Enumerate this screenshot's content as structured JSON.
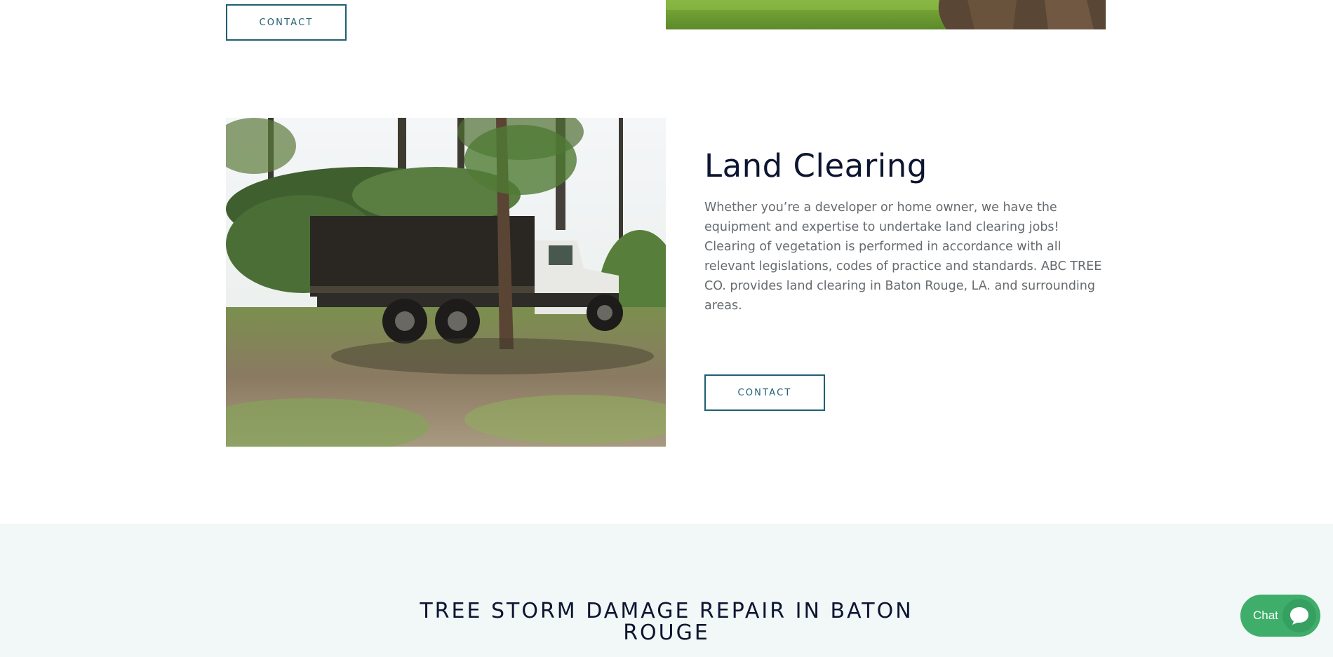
{
  "top_section": {
    "contact_label": "CONTACT"
  },
  "service": {
    "title": "Land Clearing",
    "description": "Whether you’re a developer or home owner, we have the equipment and expertise to undertake land clearing jobs! Clearing of vegetation is performed in accordance with all relevant legislations, codes of practice and standards. ABC TREE CO. provides land clearing in Baton Rouge, LA. and surrounding areas.",
    "contact_label": "CONTACT"
  },
  "next_section": {
    "title": "TREE STORM DAMAGE REPAIR IN BATON ROUGE"
  },
  "chat_widget": {
    "label": "Chat"
  },
  "colors": {
    "accent": "#1f5f73",
    "heading": "#0d1530",
    "body_text": "#666b6f",
    "band_bg": "#f2f7f7",
    "chat_green": "#3fae6a"
  },
  "icons": [
    "chat-bubble-icon"
  ]
}
